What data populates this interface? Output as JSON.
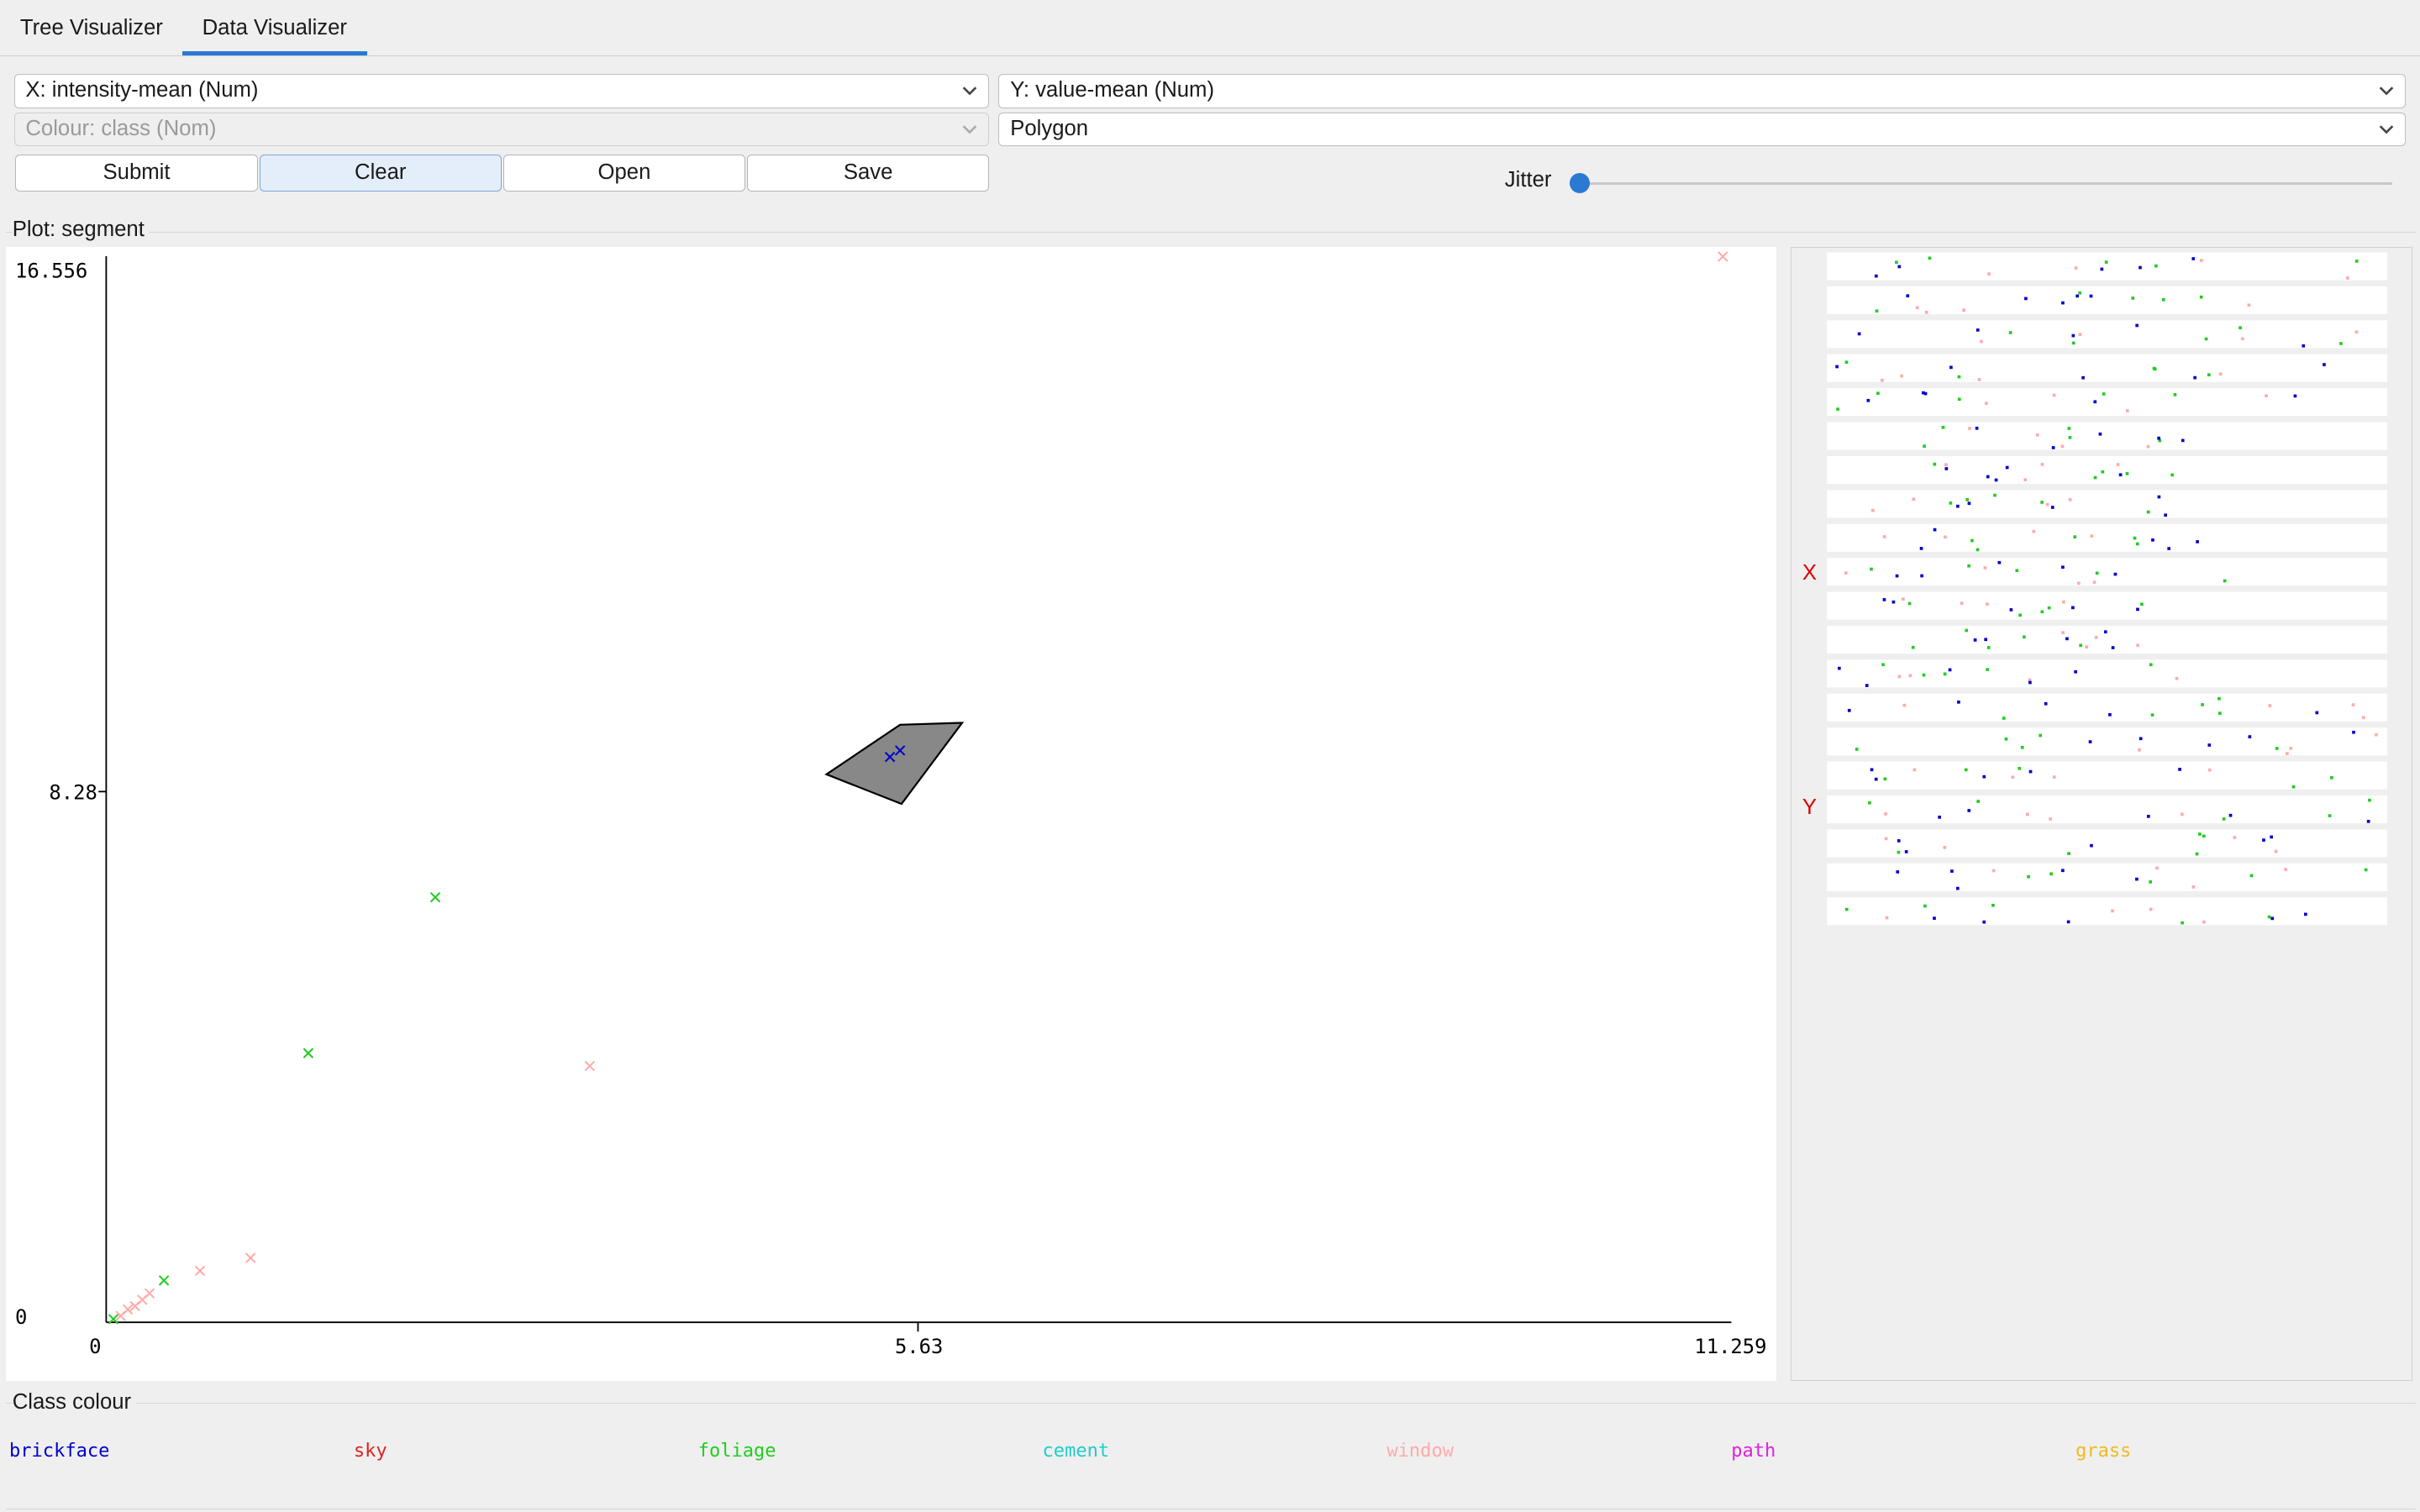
{
  "tabs": [
    {
      "label": "Tree Visualizer"
    },
    {
      "label": "Data Visualizer"
    }
  ],
  "controls": {
    "x_axis": "X: intensity-mean (Num)",
    "y_axis": "Y: value-mean (Num)",
    "colour": "Colour: class (Nom)",
    "shape": "Polygon",
    "buttons": {
      "submit": "Submit",
      "clear": "Clear",
      "open": "Open",
      "save": "Save"
    },
    "jitter_label": "Jitter",
    "jitter_value": 0
  },
  "plot": {
    "label": "Plot: segment",
    "y_ticks": [
      "16.556",
      "8.28",
      "0"
    ],
    "x_ticks": [
      "0",
      "5.63",
      "11.259"
    ]
  },
  "matrix": {
    "x_marker": "X",
    "y_marker": "Y"
  },
  "legend": {
    "label": "Class colour",
    "items": [
      {
        "name": "brickface",
        "color": "#0000cc"
      },
      {
        "name": "sky",
        "color": "#dd2222"
      },
      {
        "name": "foliage",
        "color": "#22cc22"
      },
      {
        "name": "cement",
        "color": "#22cccc"
      },
      {
        "name": "window",
        "color": "#ffaaaa"
      },
      {
        "name": "path",
        "color": "#dd22dd"
      },
      {
        "name": "grass",
        "color": "#eebb22"
      }
    ]
  },
  "chart_data": {
    "type": "scatter",
    "xlabel": "intensity-mean",
    "ylabel": "value-mean",
    "xlim": [
      0,
      11.259
    ],
    "ylim": [
      0,
      16.556
    ],
    "points": [
      {
        "x": 0.05,
        "y": 0.05,
        "class": "foliage"
      },
      {
        "x": 0.1,
        "y": 0.1,
        "class": "window"
      },
      {
        "x": 0.15,
        "y": 0.2,
        "class": "window"
      },
      {
        "x": 0.2,
        "y": 0.25,
        "class": "window"
      },
      {
        "x": 0.25,
        "y": 0.35,
        "class": "window"
      },
      {
        "x": 0.3,
        "y": 0.45,
        "class": "window"
      },
      {
        "x": 0.4,
        "y": 0.65,
        "class": "foliage"
      },
      {
        "x": 0.65,
        "y": 0.8,
        "class": "window"
      },
      {
        "x": 1.0,
        "y": 1.0,
        "class": "window"
      },
      {
        "x": 1.4,
        "y": 4.18,
        "class": "foliage"
      },
      {
        "x": 2.28,
        "y": 6.6,
        "class": "foliage"
      },
      {
        "x": 3.35,
        "y": 3.98,
        "class": "window"
      },
      {
        "x": 5.43,
        "y": 8.78,
        "class": "brickface"
      },
      {
        "x": 5.5,
        "y": 8.88,
        "class": "brickface"
      },
      {
        "x": 11.2,
        "y": 16.55,
        "class": "window"
      }
    ],
    "polygon": [
      [
        4.99,
        8.51
      ],
      [
        5.5,
        9.28
      ],
      [
        5.93,
        9.31
      ],
      [
        5.51,
        8.05
      ]
    ]
  }
}
